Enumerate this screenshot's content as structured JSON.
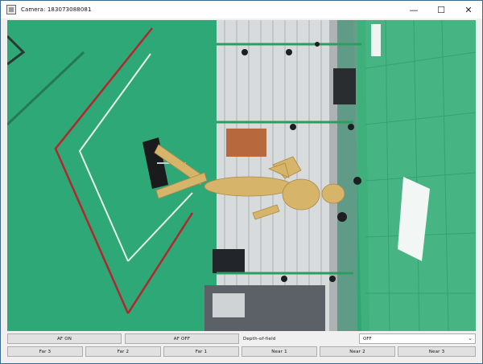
{
  "window": {
    "title": "Camera: 183073088081",
    "controls": {
      "minimize": "—",
      "maximize": "☐",
      "close": "✕"
    }
  },
  "viewport": {
    "description_icon": "camera-feed"
  },
  "controls": {
    "af_on_label": "AF ON",
    "af_off_label": "AF OFF",
    "depth_of_field_label": "Depth-of-field",
    "depth_of_field_value": "OFF",
    "focus_buttons": [
      "Far 3",
      "Far 2",
      "Far 1",
      "Near 1",
      "Near 2",
      "Near 3"
    ]
  },
  "colors": {
    "floor": "#2ea676",
    "wall": "#3fb07c",
    "mannequin": "#d6b56a",
    "red_tape": "#b3262c",
    "white_tape": "#e9f3ee"
  }
}
